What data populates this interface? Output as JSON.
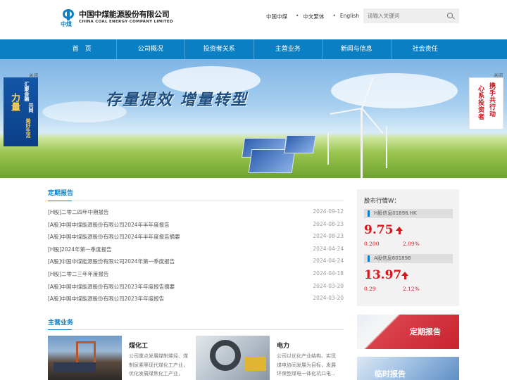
{
  "brand": {
    "logo_cn": "中国中煤能源股份有限公司",
    "logo_en": "CHINA COAL ENERGY COMPANY LIMITED",
    "logo_mark": "中煤"
  },
  "toplinks": [
    "中国中煤",
    "中文繁体",
    "English"
  ],
  "search": {
    "placeholder": "请输入关键词"
  },
  "nav": [
    "首　页",
    "公司概况",
    "投资者关系",
    "主营业务",
    "新闻与信息",
    "社会责任"
  ],
  "banner": {
    "slogan": "存量提效 增量转型",
    "close_label": "关闭",
    "left_ad": [
      "汇聚金融",
      "力量",
      "共同",
      "美好生活"
    ],
    "right_ad": [
      "携手共行动",
      "心系投资者"
    ]
  },
  "periodic_reports": {
    "title": "定期报告",
    "items": [
      {
        "title": "[H股]二零二四年中期报告",
        "date": "2024-09-12"
      },
      {
        "title": "[A股]中国中煤能源股份有限公司2024年半年度报告",
        "date": "2024-08-23"
      },
      {
        "title": "[A股]中国中煤能源股份有限公司2024年半年度报告摘要",
        "date": "2024-08-23"
      },
      {
        "title": "[H股]2024年第一季度报告",
        "date": "2024-04-24"
      },
      {
        "title": "[A股]中国中煤能源股份有限公司2024年第一季度报告",
        "date": "2024-04-24"
      },
      {
        "title": "[H股]二零二三年年度报告",
        "date": "2024-04-18"
      },
      {
        "title": "[A股]中国中煤能源股份有限公司2023年年度报告摘要",
        "date": "2024-03-20"
      },
      {
        "title": "[A股]中国中煤能源股份有限公司2023年年度报告",
        "date": "2024-03-20"
      }
    ]
  },
  "stock": {
    "title": "股市行情W：",
    "h": {
      "label": "H股信息01898.HK",
      "price": "9.75",
      "change": "0.200",
      "pct": "2.09%"
    },
    "a": {
      "label": "A股信息601898",
      "price": "13.97",
      "change": "0.29",
      "pct": "2.12%"
    },
    "trend_color": "#d6181e"
  },
  "business": {
    "title": "主营业务",
    "items": [
      {
        "name": "煤化工",
        "desc": "公司重点发展煤制烯烃、煤制尿素等现代煤化工产业，优化发展煤焦化工产业，产..."
      },
      {
        "name": "电力",
        "desc": "公司以优化产业结构、实现煤电协同发展为目标，发展环保型煤电一体化坑口电..."
      }
    ]
  },
  "promos": [
    "定期报告",
    "临时报告"
  ],
  "colors": {
    "brand_blue": "#0b7fc3",
    "up_red": "#d6181e"
  }
}
